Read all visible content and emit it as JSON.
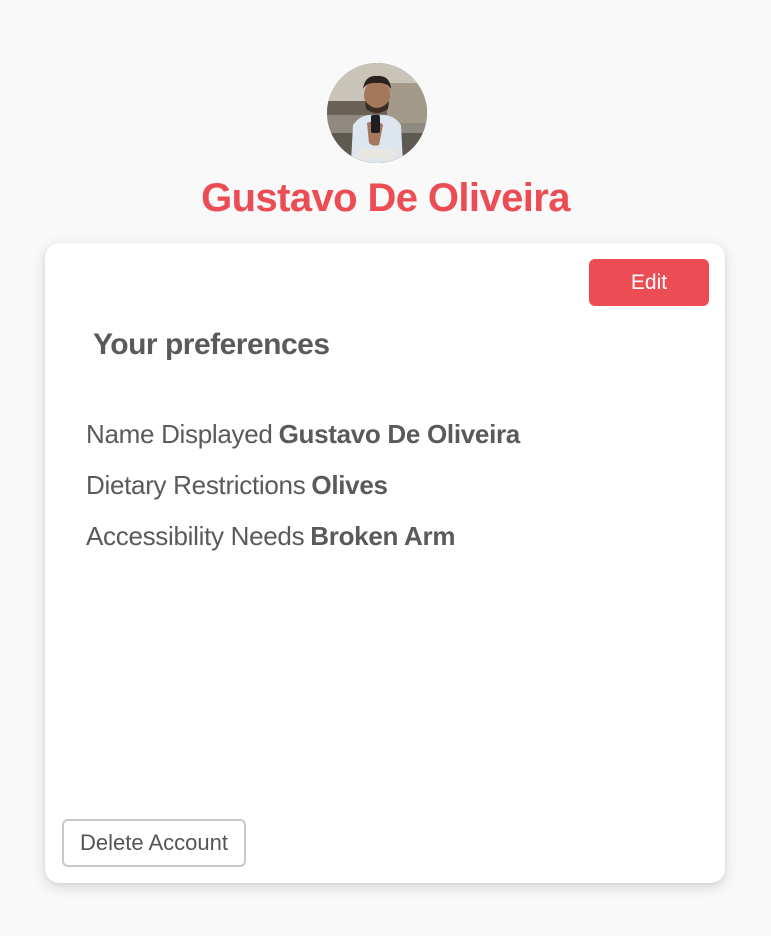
{
  "profile": {
    "name": "Gustavo De Oliveira",
    "avatar_icon": "user-photo",
    "accent_color": "#ec4d55"
  },
  "card": {
    "edit_label": "Edit",
    "section_title": "Your preferences",
    "preferences": [
      {
        "label": "Name Displayed",
        "value": "Gustavo De Oliveira"
      },
      {
        "label": "Dietary Restrictions",
        "value": "Olives"
      },
      {
        "label": "Accessibility Needs",
        "value": "Broken Arm"
      }
    ],
    "delete_label": "Delete Account"
  }
}
